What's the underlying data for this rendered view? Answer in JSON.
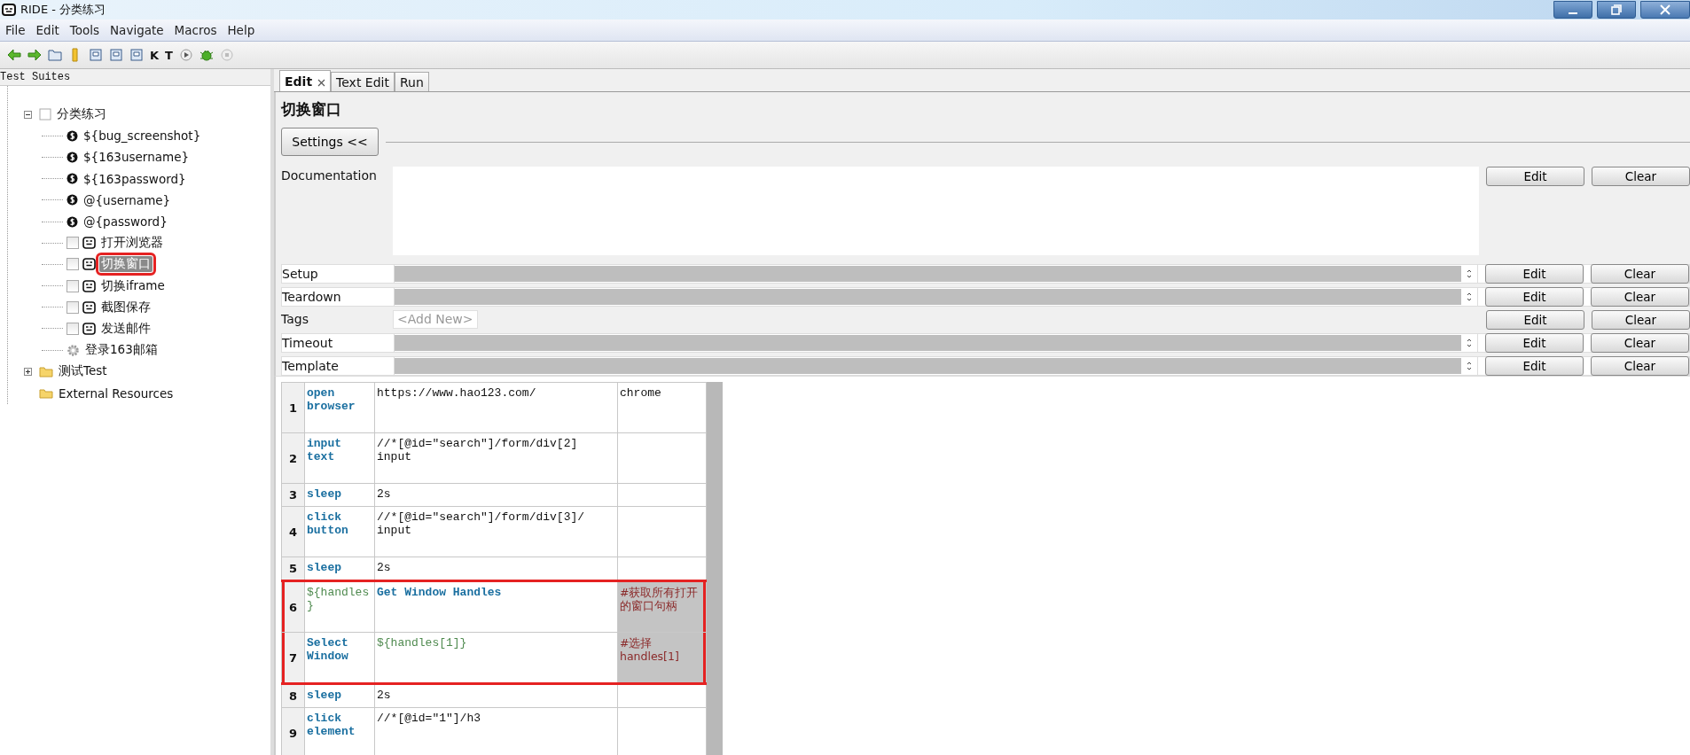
{
  "window": {
    "title": "RIDE - 分类练习"
  },
  "menu": [
    "File",
    "Edit",
    "Tools",
    "Navigate",
    "Macros",
    "Help"
  ],
  "toolbar_letters": [
    "K",
    "T"
  ],
  "tree": {
    "header": "Test Suites",
    "items": [
      {
        "label": "分类练习",
        "kind": "suite",
        "expanded": true,
        "children": [
          {
            "label": "${bug_screenshot}",
            "kind": "variable"
          },
          {
            "label": "${163username}",
            "kind": "variable"
          },
          {
            "label": "${163password}",
            "kind": "variable"
          },
          {
            "label": "@{username}",
            "kind": "variable"
          },
          {
            "label": "@{password}",
            "kind": "variable"
          },
          {
            "label": "打开浏览器",
            "kind": "test",
            "checked": false,
            "selected": false
          },
          {
            "label": "切换窗口",
            "kind": "test",
            "checked": false,
            "selected": true
          },
          {
            "label": "切换iframe",
            "kind": "test",
            "checked": false,
            "selected": false
          },
          {
            "label": "截图保存",
            "kind": "test",
            "checked": false,
            "selected": false
          },
          {
            "label": "发送邮件",
            "kind": "test",
            "checked": false,
            "selected": false
          },
          {
            "label": "登录163邮箱",
            "kind": "keyword"
          }
        ]
      },
      {
        "label": "测试Test",
        "kind": "folder",
        "expanded": false
      },
      {
        "label": "External Resources",
        "kind": "resources"
      }
    ]
  },
  "tabs": [
    {
      "label": "Edit",
      "selected": true,
      "closable": true
    },
    {
      "label": "Text Edit",
      "selected": false,
      "closable": false
    },
    {
      "label": "Run",
      "selected": false,
      "closable": false
    }
  ],
  "heading": "切换窗口",
  "settings_toggle": "Settings <<",
  "settings": [
    {
      "label": "Documentation",
      "kind": "doc",
      "edit": "Edit",
      "clear": "Clear"
    },
    {
      "label": "Setup",
      "kind": "combo",
      "edit": "Edit",
      "clear": "Clear"
    },
    {
      "label": "Teardown",
      "kind": "combo",
      "edit": "Edit",
      "clear": "Clear"
    },
    {
      "label": "Tags",
      "kind": "tags",
      "placeholder": "<Add New>",
      "edit": "Edit",
      "clear": "Clear"
    },
    {
      "label": "Timeout",
      "kind": "combo",
      "edit": "Edit",
      "clear": "Clear"
    },
    {
      "label": "Template",
      "kind": "combo",
      "edit": "Edit",
      "clear": "Clear"
    }
  ],
  "steps": [
    {
      "number": "1",
      "highlighted": false,
      "cells": [
        {
          "text": "open browser",
          "kind": "keyword"
        },
        {
          "text": "https://www.hao123.com/",
          "kind": "text"
        },
        {
          "text": "chrome",
          "kind": "text"
        }
      ]
    },
    {
      "number": "2",
      "highlighted": false,
      "cells": [
        {
          "text": "input text",
          "kind": "keyword"
        },
        {
          "text": "//*[@id=\"search\"]/form/div[2] input",
          "kind": "text"
        },
        {
          "text": "",
          "kind": "text"
        }
      ]
    },
    {
      "number": "3",
      "highlighted": false,
      "cells": [
        {
          "text": "sleep",
          "kind": "keyword"
        },
        {
          "text": "2s",
          "kind": "text"
        },
        {
          "text": "",
          "kind": "text"
        }
      ]
    },
    {
      "number": "4",
      "highlighted": false,
      "cells": [
        {
          "text": "click button",
          "kind": "keyword"
        },
        {
          "text": "//*[@id=\"search\"]/form/div[3]/ input",
          "kind": "text"
        },
        {
          "text": "",
          "kind": "text"
        }
      ]
    },
    {
      "number": "5",
      "highlighted": false,
      "cells": [
        {
          "text": "sleep",
          "kind": "keyword"
        },
        {
          "text": "2s",
          "kind": "text"
        },
        {
          "text": "",
          "kind": "text"
        }
      ]
    },
    {
      "number": "6",
      "highlighted": true,
      "cells": [
        {
          "text": "${handles}",
          "kind": "variable"
        },
        {
          "text": "Get Window Handles",
          "kind": "keyword"
        },
        {
          "text": "#获取所有打开的窗口句柄",
          "kind": "comment"
        }
      ]
    },
    {
      "number": "7",
      "highlighted": true,
      "cells": [
        {
          "text": "Select Window",
          "kind": "keyword"
        },
        {
          "text": "${handles[1]}",
          "kind": "variable"
        },
        {
          "text": "#选择handles[1]",
          "kind": "comment"
        }
      ]
    },
    {
      "number": "8",
      "highlighted": false,
      "cells": [
        {
          "text": "sleep",
          "kind": "keyword"
        },
        {
          "text": "2s",
          "kind": "text"
        },
        {
          "text": "",
          "kind": "text"
        }
      ]
    },
    {
      "number": "9",
      "highlighted": false,
      "cells": [
        {
          "text": "click element",
          "kind": "keyword"
        },
        {
          "text": "//*[@id=\"1\"]/h3",
          "kind": "text"
        },
        {
          "text": "",
          "kind": "text"
        }
      ]
    }
  ]
}
